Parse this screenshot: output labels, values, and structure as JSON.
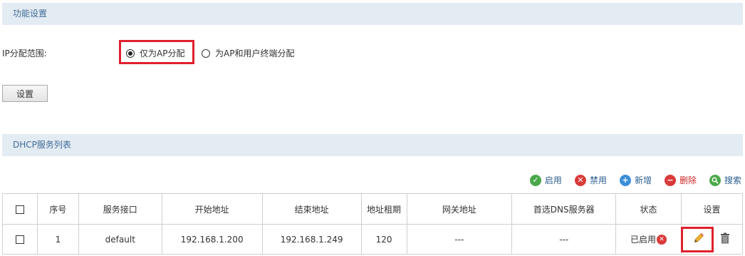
{
  "settings": {
    "title": "功能设置",
    "ip_label": "IP分配范围:",
    "radio_options": [
      {
        "label": "仅为AP分配",
        "checked": true
      },
      {
        "label": "为AP和用户终端分配",
        "checked": false
      }
    ],
    "set_button": "设置"
  },
  "dhcp": {
    "title": "DHCP服务列表",
    "toolbar": {
      "enable": "启用",
      "disable": "禁用",
      "add": "新增",
      "delete": "删除",
      "search": "搜索"
    },
    "columns": [
      "序号",
      "服务接口",
      "开始地址",
      "结束地址",
      "地址租期",
      "网关地址",
      "首选DNS服务器",
      "状态",
      "设置"
    ],
    "rows": [
      {
        "index": "1",
        "interface": "default",
        "start": "192.168.1.200",
        "end": "192.168.1.249",
        "lease": "120",
        "gateway": "---",
        "dns": "---",
        "status": "已启用"
      }
    ]
  },
  "icons": {
    "enable": "check-circle-icon",
    "disable": "x-circle-icon",
    "add": "plus-circle-icon",
    "delete": "minus-circle-icon",
    "search": "magnifier-icon",
    "edit": "pencil-icon",
    "remove": "trash-icon"
  },
  "colors": {
    "header_bg": "#e3ebf3",
    "header_text": "#3f6c97",
    "highlight": "#e0202e",
    "green": "#4aa84a",
    "red": "#d93a3a",
    "blue": "#3a8fd9"
  }
}
